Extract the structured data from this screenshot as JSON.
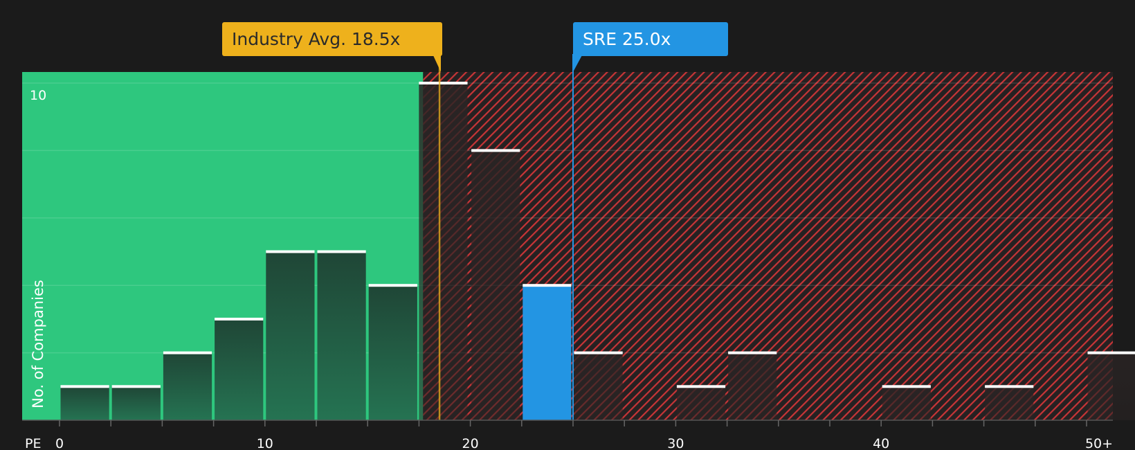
{
  "chart_data": {
    "type": "bar",
    "x_axis_label": "PE",
    "y_axis_label": "No. of Companies",
    "x_ticks": [
      "0",
      "10",
      "20",
      "30",
      "40",
      "50+"
    ],
    "y_ticks": [
      "10"
    ],
    "ylim": [
      0,
      10.4
    ],
    "bin_width": 2.5,
    "bins": [
      {
        "x_start": 0,
        "value": 1
      },
      {
        "x_start": 2.5,
        "value": 1
      },
      {
        "x_start": 5,
        "value": 2
      },
      {
        "x_start": 7.5,
        "value": 3
      },
      {
        "x_start": 10,
        "value": 5
      },
      {
        "x_start": 12.5,
        "value": 5
      },
      {
        "x_start": 15,
        "value": 4
      },
      {
        "x_start": 17.5,
        "value": 10
      },
      {
        "x_start": 20,
        "value": 8
      },
      {
        "x_start": 22.5,
        "value": 4,
        "highlight": true
      },
      {
        "x_start": 25,
        "value": 2
      },
      {
        "x_start": 30,
        "value": 1
      },
      {
        "x_start": 32.5,
        "value": 2
      },
      {
        "x_start": 40,
        "value": 1
      },
      {
        "x_start": 45,
        "value": 1
      },
      {
        "x_start": 50,
        "value": 2
      }
    ],
    "undervalued_zone_end": 17.7,
    "industry_avg": 18.5,
    "company_value": 25.0,
    "grid": true,
    "colors": {
      "background": "#1b1b1b",
      "green_zone": "#2ec77e",
      "red_hatch": "#d0383a",
      "bar_dark": "#1f4636",
      "bar_highlight": "#2395e3",
      "industry": "#eeb11c",
      "company": "#2395e3"
    }
  },
  "callouts": {
    "industry": "Industry Avg. 18.5x",
    "company": "SRE 25.0x"
  }
}
